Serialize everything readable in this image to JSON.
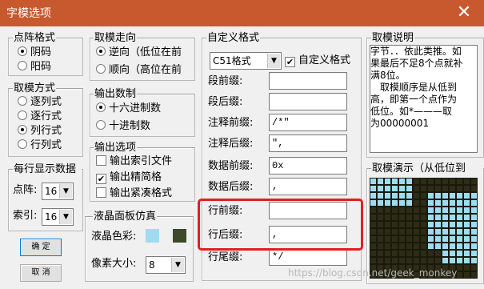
{
  "window": {
    "title": "字模选项",
    "close_glyph": "✕"
  },
  "dot_format": {
    "title": "点阵格式",
    "options": [
      "阴码",
      "阳码"
    ],
    "selected": 0
  },
  "scan_mode": {
    "title": "取模方式",
    "options": [
      "逐列式",
      "逐行式",
      "列行式",
      "行列式"
    ],
    "selected": 2
  },
  "per_line": {
    "title": "每行显示数据",
    "dot_label": "点阵:",
    "dot_value": "16",
    "index_label": "索引:",
    "index_value": "16"
  },
  "buttons": {
    "ok": "确 定",
    "cancel": "取 消"
  },
  "direction": {
    "title": "取模走向",
    "options": [
      "逆向（低位在前",
      "顺向（高位在前"
    ],
    "selected": 0
  },
  "number_base": {
    "title": "输出数制",
    "options": [
      "十六进制数",
      "十进制数"
    ],
    "selected": 0
  },
  "output_options": {
    "title": "输出选项",
    "items": [
      {
        "label": "输出索引文件",
        "checked": false
      },
      {
        "label": "输出精简格",
        "checked": true
      },
      {
        "label": "输出紧凑格式",
        "checked": false
      }
    ]
  },
  "lcd": {
    "title": "液晶面板仿真",
    "color_label": "液晶色彩:",
    "pixel_label": "像素大小:",
    "pixel_value": "8",
    "colors": [
      "#9fdcf0",
      "#3c4a2a"
    ]
  },
  "custom_format": {
    "title": "自定义格式",
    "preset": "C51格式",
    "custom_check_label": "自定义格式",
    "custom_checked": true,
    "fields": [
      {
        "label": "段前缀:",
        "value": ""
      },
      {
        "label": "段后缀:",
        "value": ""
      },
      {
        "label": "注释前缀:",
        "value": "/*\""
      },
      {
        "label": "注释后缀:",
        "value": "\","
      },
      {
        "label": "数据前缀:",
        "value": "0x"
      },
      {
        "label": "数据后缀:",
        "value": ","
      },
      {
        "label": "行前缀:",
        "value": ""
      },
      {
        "label": "行后缀:",
        "value": ","
      },
      {
        "label": "行尾缀:",
        "value": "*/"
      }
    ]
  },
  "explanation": {
    "title": "取模说明",
    "lines": [
      "字节．．依此类推。如",
      "果最后不足8个点就补",
      "满8位。",
      "　取模顺序是从低到",
      "高，即第一个点作为",
      "低位。如*———取",
      "为00000001"
    ]
  },
  "demo": {
    "title": "取模演示（从低位到",
    "lit_color": "#9fdcf0",
    "dark_color": "#1a1a0a"
  },
  "watermark": "https://blog.csdn.net/geek_monkey"
}
